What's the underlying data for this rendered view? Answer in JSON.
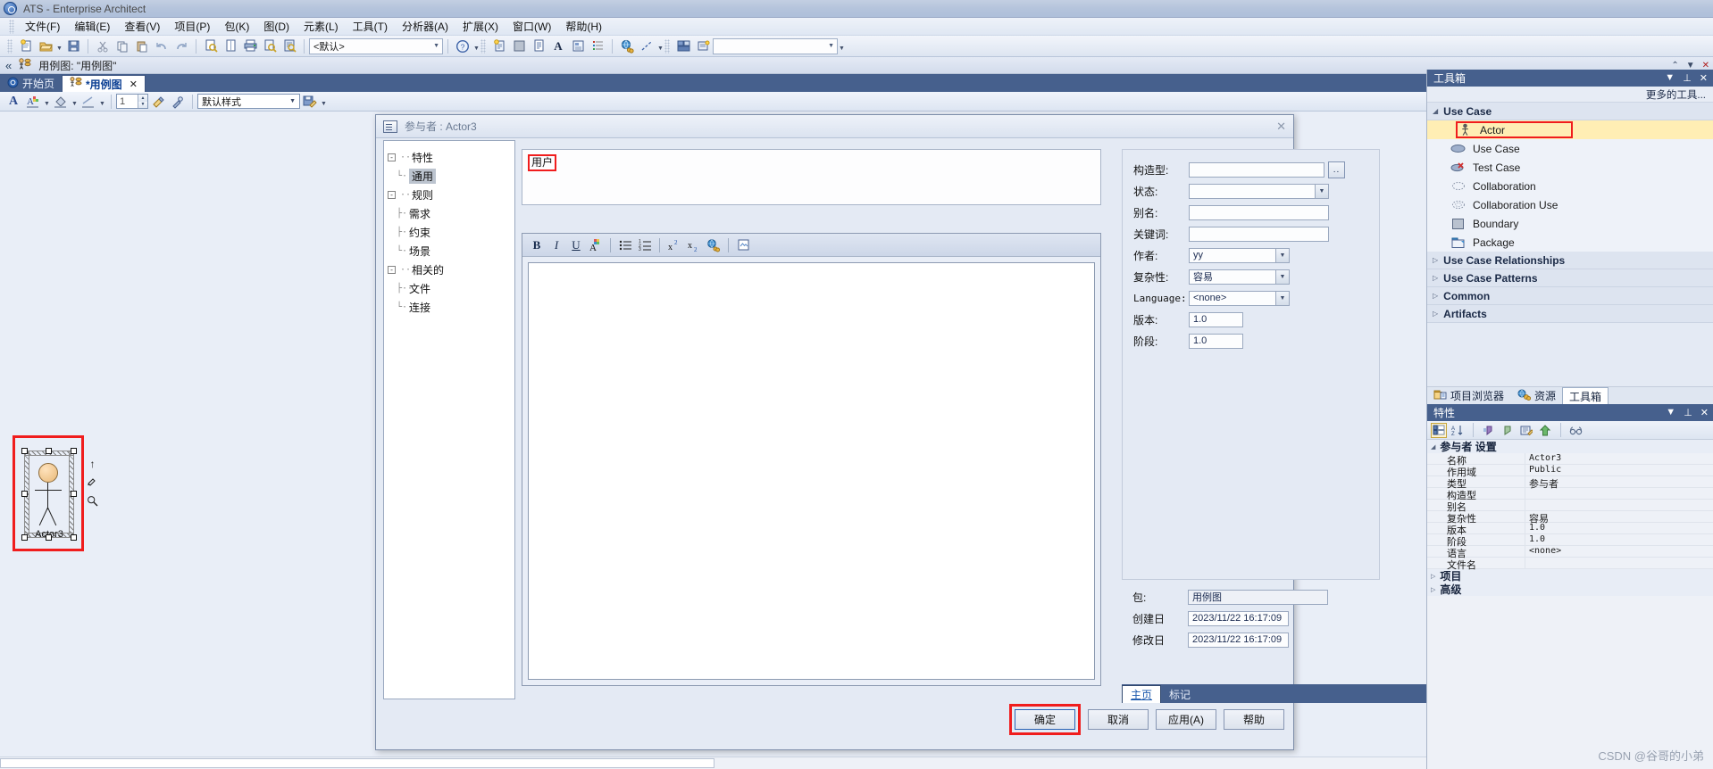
{
  "window": {
    "title": "ATS - Enterprise Architect",
    "logo_icon": "app-logo-icon"
  },
  "menubar": [
    {
      "label": "文件(F)"
    },
    {
      "label": "编辑(E)"
    },
    {
      "label": "查看(V)"
    },
    {
      "label": "项目(P)"
    },
    {
      "label": "包(K)"
    },
    {
      "label": "图(D)"
    },
    {
      "label": "元素(L)"
    },
    {
      "label": "工具(T)"
    },
    {
      "label": "分析器(A)"
    },
    {
      "label": "扩展(X)"
    },
    {
      "label": "窗口(W)"
    },
    {
      "label": "帮助(H)"
    }
  ],
  "toolbar": {
    "style_combo_value": "<默认>",
    "right_combo_value": "",
    "icons": [
      "new-file-icon",
      "open-folder-icon",
      "save-icon",
      "cut-icon",
      "copy-icon",
      "paste-icon",
      "undo-icon",
      "redo-icon",
      "search-document-icon",
      "page-icon",
      "print-icon",
      "find-icon",
      "inspect-icon",
      "help-icon",
      "new-diagram-icon",
      "image-icon",
      "document-icon",
      "text-icon",
      "element-icon",
      "list-icon",
      "globe-link-icon",
      "line-icon",
      "layout-icon",
      "model-icon"
    ]
  },
  "breadcrumb": {
    "icon": "actor-icon",
    "text": "用例图: \"用例图\"",
    "controls": [
      "collapse-icon",
      "dropdown-icon",
      "close-icon"
    ]
  },
  "tabs": {
    "items": [
      {
        "label": "开始页",
        "icon": "start-page-icon",
        "active": false,
        "closable": false
      },
      {
        "label": "*用例图",
        "icon": "use-case-diagram-icon",
        "active": true,
        "closable": true
      }
    ],
    "nav_prev": "◀",
    "nav_next": "▶"
  },
  "formatbar": {
    "style_value": "默认样式",
    "line_width": "1",
    "icons": [
      "font-color-icon",
      "text-style-icon",
      "fill-color-icon",
      "line-style-icon",
      "format-painter-icon",
      "eyedropper-icon",
      "save-style-icon"
    ]
  },
  "canvas": {
    "actor": {
      "label": "Actor3",
      "selected": true,
      "quick_icons": [
        "arrow-up-icon",
        "pencil-icon",
        "magnifier-icon"
      ]
    }
  },
  "dialog": {
    "title": "参与者 : Actor3",
    "icon": "properties-dialog-icon",
    "close_label": "✕",
    "tree": [
      {
        "label": "特性",
        "level": 0,
        "expander": "-"
      },
      {
        "label": "通用",
        "level": 1,
        "selected": true
      },
      {
        "label": "规则",
        "level": 0,
        "expander": "-"
      },
      {
        "label": "需求",
        "level": 1
      },
      {
        "label": "约束",
        "level": 1
      },
      {
        "label": "场景",
        "level": 1
      },
      {
        "label": "相关的",
        "level": 0,
        "expander": "-"
      },
      {
        "label": "文件",
        "level": 1
      },
      {
        "label": "连接",
        "level": 1
      }
    ],
    "name_value": "用户",
    "notes_value": "",
    "editor_icons": [
      "bold-icon",
      "italic-icon",
      "underline-icon",
      "font-color-icon",
      "bullet-list-icon",
      "numbered-list-icon",
      "superscript-icon",
      "subscript-icon",
      "hyperlink-icon",
      "insert-object-icon"
    ],
    "fields": [
      {
        "key": "stereotype",
        "label": "构造型:",
        "value": "",
        "control": "text-ellipsis"
      },
      {
        "key": "status",
        "label": "状态:",
        "value": "",
        "control": "combo"
      },
      {
        "key": "alias",
        "label": "别名:",
        "value": "",
        "control": "text"
      },
      {
        "key": "keywords",
        "label": "关键词:",
        "value": "",
        "control": "text"
      },
      {
        "key": "author",
        "label": "作者:",
        "value": "yy",
        "control": "combo"
      },
      {
        "key": "complexity",
        "label": "复杂性:",
        "value": "容易",
        "control": "combo"
      },
      {
        "key": "language",
        "label": "Language:",
        "value": "<none>",
        "control": "combo",
        "mono": true
      },
      {
        "key": "version",
        "label": "版本:",
        "value": "1.0",
        "control": "text-small"
      },
      {
        "key": "phase",
        "label": "阶段:",
        "value": "1.0",
        "control": "text-small"
      }
    ],
    "fields2": [
      {
        "key": "package",
        "label": "包:",
        "value": "用例图"
      },
      {
        "key": "created",
        "label": "创建日",
        "value": "2023/11/22 16:17:09"
      },
      {
        "key": "modified",
        "label": "修改日",
        "value": "2023/11/22 16:17:09"
      }
    ],
    "bottom_tabs": [
      {
        "label": "主页",
        "active": true
      },
      {
        "label": "标记",
        "active": false
      }
    ],
    "buttons": [
      {
        "label": "确定",
        "primary": true,
        "highlighted": true
      },
      {
        "label": "取消",
        "primary": false,
        "highlighted": false
      },
      {
        "label": "应用(A)",
        "primary": false,
        "highlighted": false
      },
      {
        "label": "帮助",
        "primary": false,
        "highlighted": false
      }
    ]
  },
  "toolbox": {
    "title": "工具箱",
    "more_tools": "更多的工具...",
    "header_buttons": [
      "dropdown-icon",
      "pin-icon",
      "close-icon"
    ],
    "groups": [
      {
        "label": "Use Case",
        "expanded": true,
        "items": [
          {
            "label": "Actor",
            "icon": "actor-icon",
            "selected": true
          },
          {
            "label": "Use Case",
            "icon": "use-case-ellipse-icon",
            "selected": false
          },
          {
            "label": "Test Case",
            "icon": "test-case-icon",
            "selected": false
          },
          {
            "label": "Collaboration",
            "icon": "collaboration-icon",
            "selected": false
          },
          {
            "label": "Collaboration Use",
            "icon": "collaboration-use-icon",
            "selected": false
          },
          {
            "label": "Boundary",
            "icon": "boundary-icon",
            "selected": false
          },
          {
            "label": "Package",
            "icon": "package-icon",
            "selected": false
          }
        ]
      },
      {
        "label": "Use Case Relationships",
        "expanded": false,
        "items": []
      },
      {
        "label": "Use Case Patterns",
        "expanded": false,
        "items": []
      },
      {
        "label": "Common",
        "expanded": false,
        "items": []
      },
      {
        "label": "Artifacts",
        "expanded": false,
        "items": []
      }
    ]
  },
  "pane_tabs": [
    {
      "label": "项目浏览器",
      "icon": "project-browser-icon",
      "active": false
    },
    {
      "label": "资源",
      "icon": "resources-icon",
      "active": false
    },
    {
      "label": "工具箱",
      "icon": "toolbox-icon",
      "active": true
    }
  ],
  "properties": {
    "title": "特性",
    "header_buttons": [
      "dropdown-icon",
      "pin-icon",
      "close-icon"
    ],
    "toolbar_icons": [
      "categorized-icon",
      "sort-az-icon",
      "add-icon",
      "check-icon",
      "edit-icon",
      "up-arrow-icon",
      "glasses-icon"
    ],
    "group_label": "参与者 设置",
    "rows": [
      {
        "key": "名称",
        "value": "Actor3",
        "mono": true
      },
      {
        "key": "作用域",
        "value": "Public",
        "mono": true
      },
      {
        "key": "类型",
        "value": "参与者",
        "mono": false
      },
      {
        "key": "构造型",
        "value": "",
        "mono": true
      },
      {
        "key": "别名",
        "value": "",
        "mono": true
      },
      {
        "key": "复杂性",
        "value": "容易",
        "mono": false
      },
      {
        "key": "版本",
        "value": "1.0",
        "mono": true
      },
      {
        "key": "阶段",
        "value": "1.0",
        "mono": true
      },
      {
        "key": "语言",
        "value": "<none>",
        "mono": true
      },
      {
        "key": "文件名",
        "value": "",
        "mono": true
      }
    ],
    "collapsed_groups": [
      {
        "label": "项目"
      },
      {
        "label": "高级"
      }
    ]
  },
  "watermark": "CSDN @谷哥的小弟",
  "colors": {
    "accent": "#46608d",
    "highlight_red": "#f01d1d",
    "selection_yellow": "#ffeeb4",
    "panel_bg": "#e4eaf4"
  }
}
